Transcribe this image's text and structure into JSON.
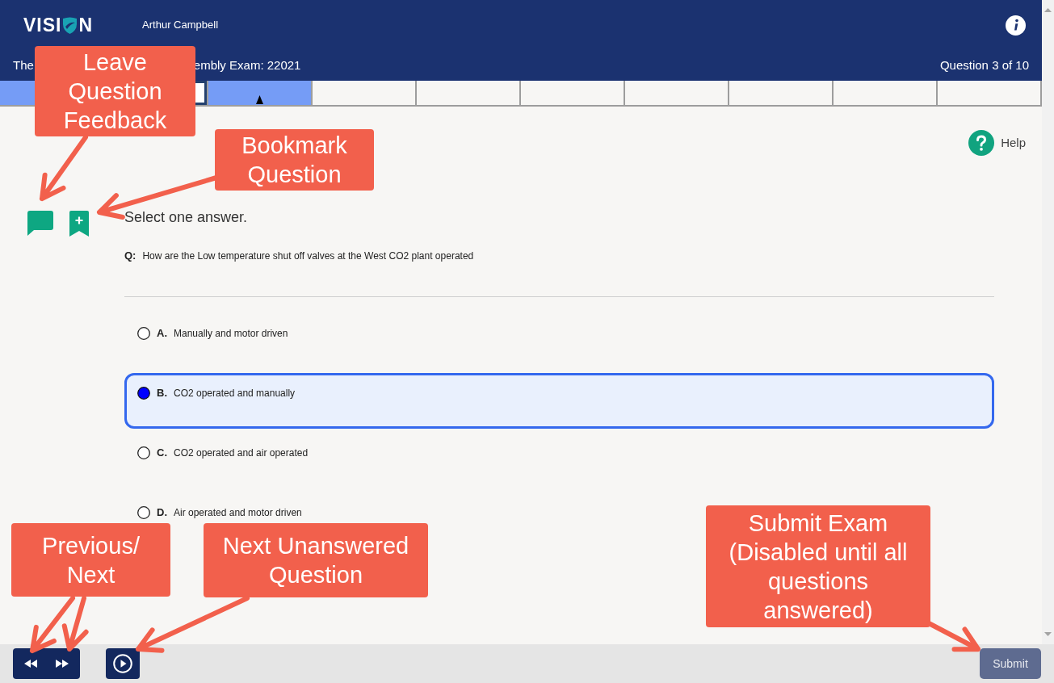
{
  "header": {
    "logo": {
      "text_before": "VISI",
      "text_after": "N"
    },
    "user_name": "Arthur Campbell",
    "exam_title_parts": [
      "The",
      "embly Exam: 22021"
    ],
    "question_counter": "Question 3 of 10"
  },
  "progress": [
    {
      "answered": true,
      "current": false,
      "focused": false
    },
    {
      "answered": false,
      "current": false,
      "focused": true
    },
    {
      "answered": true,
      "current": true,
      "focused": false
    },
    {
      "answered": false,
      "current": false,
      "focused": false
    },
    {
      "answered": false,
      "current": false,
      "focused": false
    },
    {
      "answered": false,
      "current": false,
      "focused": false
    },
    {
      "answered": false,
      "current": false,
      "focused": false
    },
    {
      "answered": false,
      "current": false,
      "focused": false
    },
    {
      "answered": false,
      "current": false,
      "focused": false
    },
    {
      "answered": false,
      "current": false,
      "focused": false
    }
  ],
  "help_label": "Help",
  "instruction": "Select one answer.",
  "question": {
    "prefix": "Q:",
    "text": "How are the Low temperature shut off valves at the West CO2 plant operated"
  },
  "options": [
    {
      "letter": "A.",
      "text": "Manually and motor driven",
      "selected": false
    },
    {
      "letter": "B.",
      "text": "CO2 operated and manually",
      "selected": true
    },
    {
      "letter": "C.",
      "text": "CO2 operated and air operated",
      "selected": false
    },
    {
      "letter": "D.",
      "text": "Air operated and motor driven",
      "selected": false
    }
  ],
  "footer": {
    "submit": {
      "label": "Submit",
      "disabled": true
    }
  },
  "annotations": [
    {
      "text": "Leave Question Feedback"
    },
    {
      "text": "Bookmark Question"
    },
    {
      "text": "Previous/ Next"
    },
    {
      "text": "Next Unanswered Question"
    },
    {
      "text": "Submit Exam (Disabled until all questions answered)"
    }
  ]
}
